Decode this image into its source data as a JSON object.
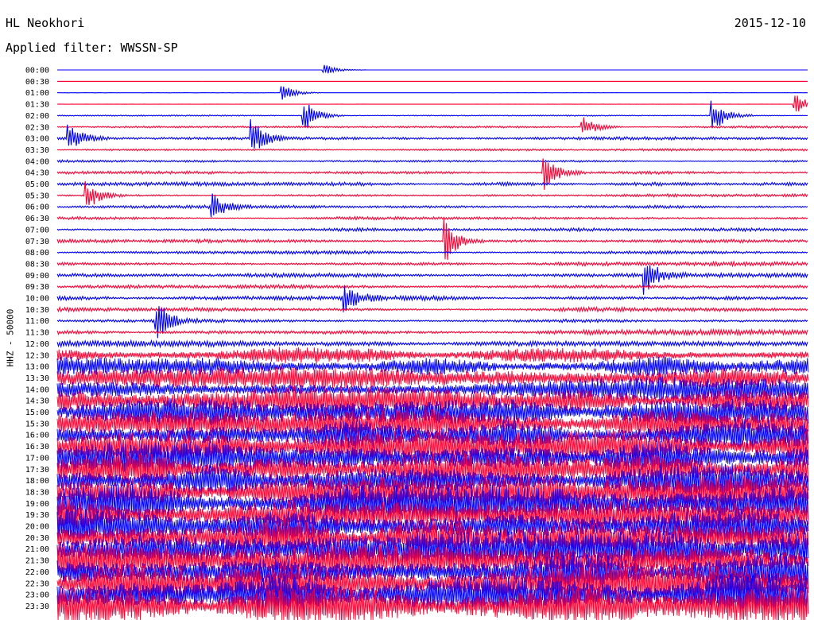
{
  "header": {
    "station": "HL Neokhori",
    "date": "2015-12-10",
    "filter_label": "Applied filter: WWSSN-SP"
  },
  "chart_data": {
    "type": "line",
    "title": "HL Neokhori",
    "ylabel": "HHZ - 50000",
    "trace_colors": [
      "#0000ff",
      "#ff0033"
    ],
    "x_unit": "minutes within trace (0-30)",
    "xlim": [
      0,
      30
    ],
    "rows": [
      "00:00",
      "00:30",
      "01:00",
      "01:30",
      "02:00",
      "02:30",
      "03:00",
      "03:30",
      "04:00",
      "04:30",
      "05:00",
      "05:30",
      "06:00",
      "06:30",
      "07:00",
      "07:30",
      "08:00",
      "08:30",
      "09:00",
      "09:30",
      "10:00",
      "10:30",
      "11:00",
      "11:30",
      "12:00",
      "12:30",
      "13:00",
      "13:30",
      "14:00",
      "14:30",
      "15:00",
      "15:30",
      "16:00",
      "16:30",
      "17:00",
      "17:30",
      "18:00",
      "18:30",
      "19:00",
      "19:30",
      "20:00",
      "20:30",
      "21:00",
      "21:30",
      "22:00",
      "22:30",
      "23:00",
      "23:30"
    ],
    "amplitude_level": [
      0.03,
      0.02,
      0.05,
      0.1,
      0.5,
      0.9,
      1.3,
      1.0,
      1.0,
      1.2,
      1.4,
      1.3,
      1.3,
      1.2,
      1.3,
      1.4,
      1.5,
      1.7,
      1.6,
      1.7,
      1.8,
      1.8,
      1.9,
      2.0,
      3.0,
      6,
      8,
      9,
      10,
      11,
      11,
      12,
      13,
      13,
      13,
      14,
      14,
      14,
      15,
      15,
      15,
      15,
      15,
      15,
      16,
      16,
      16,
      16
    ],
    "events": [
      {
        "row": "00:00",
        "x": 10.7,
        "amp": 6
      },
      {
        "row": "01:00",
        "x": 9.0,
        "amp": 10
      },
      {
        "row": "01:30",
        "x": 29.5,
        "amp": 12
      },
      {
        "row": "02:00",
        "x": 9.9,
        "amp": 18
      },
      {
        "row": "02:00",
        "x": 26.2,
        "amp": 20
      },
      {
        "row": "02:30",
        "x": 21.0,
        "amp": 14
      },
      {
        "row": "03:00",
        "x": 0.5,
        "amp": 18
      },
      {
        "row": "03:00",
        "x": 7.8,
        "amp": 22
      },
      {
        "row": "04:30",
        "x": 19.5,
        "amp": 20
      },
      {
        "row": "05:30",
        "x": 1.2,
        "amp": 18
      },
      {
        "row": "06:00",
        "x": 6.2,
        "amp": 16
      },
      {
        "row": "07:30",
        "x": 15.5,
        "amp": 26
      },
      {
        "row": "09:00",
        "x": 23.5,
        "amp": 20
      },
      {
        "row": "10:00",
        "x": 11.5,
        "amp": 18
      },
      {
        "row": "11:00",
        "x": 4.0,
        "amp": 24
      }
    ]
  }
}
